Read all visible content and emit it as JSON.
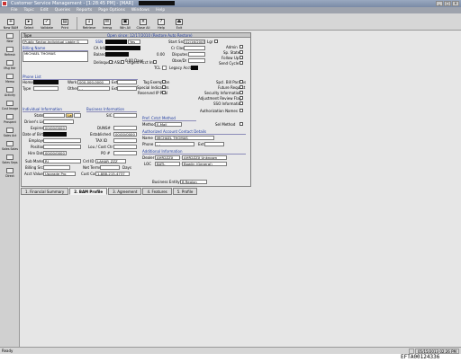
{
  "window": {
    "title": "Customer Service Management - [1:28:45 PM] - [MAR]"
  },
  "menu": [
    "File",
    "Topic",
    "Edit",
    "Queries",
    "Reports",
    "Page Options",
    "Windows",
    "Help"
  ],
  "toolbar": [
    {
      "label": "New BAM",
      "icon": "new-icon"
    },
    {
      "label": "Select",
      "icon": "select-icon"
    },
    {
      "label": "Validate",
      "icon": "check-icon"
    },
    {
      "label": "Print",
      "icon": "print-icon"
    },
    {
      "label": "Retrieve",
      "icon": "retrieve-icon"
    },
    {
      "label": "Inmsg",
      "icon": "message-icon"
    },
    {
      "label": "Win All",
      "icon": "window-icon"
    },
    {
      "label": "Close All",
      "icon": "close-icon"
    },
    {
      "label": "Help",
      "icon": "help-icon"
    },
    {
      "label": "Exit",
      "icon": "exit-icon"
    }
  ],
  "leftnav": [
    "New",
    "Refresh",
    "Msg Hdr",
    "Memo",
    "Activity",
    "Cust Image",
    "Prospect",
    "Sales Act",
    "Sales Sales",
    "Sales Seps",
    "Direct"
  ],
  "form": {
    "type_label": "Type",
    "open_since": "Open since: 12/17/2010 (Restore Auto Restore)",
    "account_type": "Public Sector-Individual Liable G",
    "billing_name_label": "Billing Name",
    "billing_name": "MICHAEL THOMAS",
    "ssn_label": "SSN",
    "ssn_type": "Yes",
    "ca_info_label": "CA Info",
    "balance_label": "Balance",
    "balance_days": "0.00 Days",
    "balance_days2": "0.00",
    "delinquent_label": "Delinquent",
    "asl_label": "ASL",
    "urgent_label": "Urgent Acct Info",
    "tcl_label": "TCL",
    "legacy_label": "Legacy Acct #",
    "start_src_label": "Start Src",
    "start_src": "02/16/2005",
    "cr_class_label": "Cr Class",
    "disputes_label": "Disputes",
    "obsolete_label": "Obse/Dr",
    "lgr_label": "Lgr",
    "admin_label": "Admin",
    "sp_state_label": "Sp. State",
    "follow_up_label": "Follow Up",
    "send_cycle_label": "Send Cycle",
    "phone_list_label": "Phone List",
    "home_label": "Home",
    "work_label": "Work",
    "work_phone": "000-000-0000",
    "ext_label": "Ext",
    "type_field_label": "Type",
    "other_label": "Other",
    "other_value": "- -",
    "tag_exemption": "Tag Exemption",
    "special_indicators": "Special Indicators",
    "reserved_ip": "Reserved IP Pool",
    "spcl_bill": "Spcl. Bill Params",
    "future_request": "Future Request",
    "security_info": "Security Information",
    "adjustment_review": "Adjustment Review Flag",
    "sso_info": "SSO Information",
    "individual_info_label": "Individual Information",
    "state_label": "State",
    "lang_label": "Lang",
    "drivers_lic_label": "Driver's Lic.",
    "expires_label": "Expires",
    "expires_value": "00/00/0000",
    "dob_label": "Date of Birth",
    "employer_label": "Employer",
    "position_label": "Position",
    "hire_date_label": "Hire Date",
    "hire_date": "00/00/0000",
    "sub_market_label": "Sub Market",
    "sub_market": "RJ",
    "billing_src_label": "Billing Src",
    "acct_value_label": "Acct Value",
    "acct_value": "Upgrade Pro",
    "business_info_label": "Business Information",
    "sic_label": "SIC",
    "duns_label": "DUNS#",
    "established_label": "Established",
    "established_value": "00/00/0000",
    "tax_id_label": "TAX ID",
    "lou_label": "Lou / Cost Ctr",
    "po_label": "PO #",
    "crd_id_label": "Crd ID",
    "crd_id": "LAHAR_ZZZ",
    "net_terms_label": "Net Terms",
    "days_label": "Days",
    "cust_care_label": "Cust Care",
    "cust_care": "1-888-215-4737",
    "authorization_names": "Authorization Names",
    "pref_contact_label": "Pref. Cntct Method",
    "method_label": "Method",
    "method_value": "E-Mail",
    "sel_method_label": "Sel Method",
    "authorized_contact_label": "Authorized Account Contact Details",
    "name_label": "Name",
    "contact_name": "MICHAEL THOMAS",
    "phone_label": "Phone",
    "phone_value": "- -",
    "additional_info_label": "Additional Information",
    "dealer_label": "Dealer",
    "dealer_code": "AHR2ZZX",
    "dealer_name": "AHR2ZZX Unknown",
    "loc_label": "LOC",
    "loc_code": "BATL",
    "loc_name": "Bowlin (General)",
    "business_entity_label": "Business Entity",
    "business_entity": "B Region"
  },
  "tabs": [
    "1. Financial Summary",
    "2. BAM Profile",
    "3. Agreement",
    "4. Features",
    "5. Profile"
  ],
  "status": {
    "left": "Ready",
    "datetime": "05/15/2013 02:26 PM"
  },
  "stamp": "EFTA00124336",
  "colors": {
    "label_blue": "#1d3aa0",
    "redaction": "#0a0a0a"
  }
}
